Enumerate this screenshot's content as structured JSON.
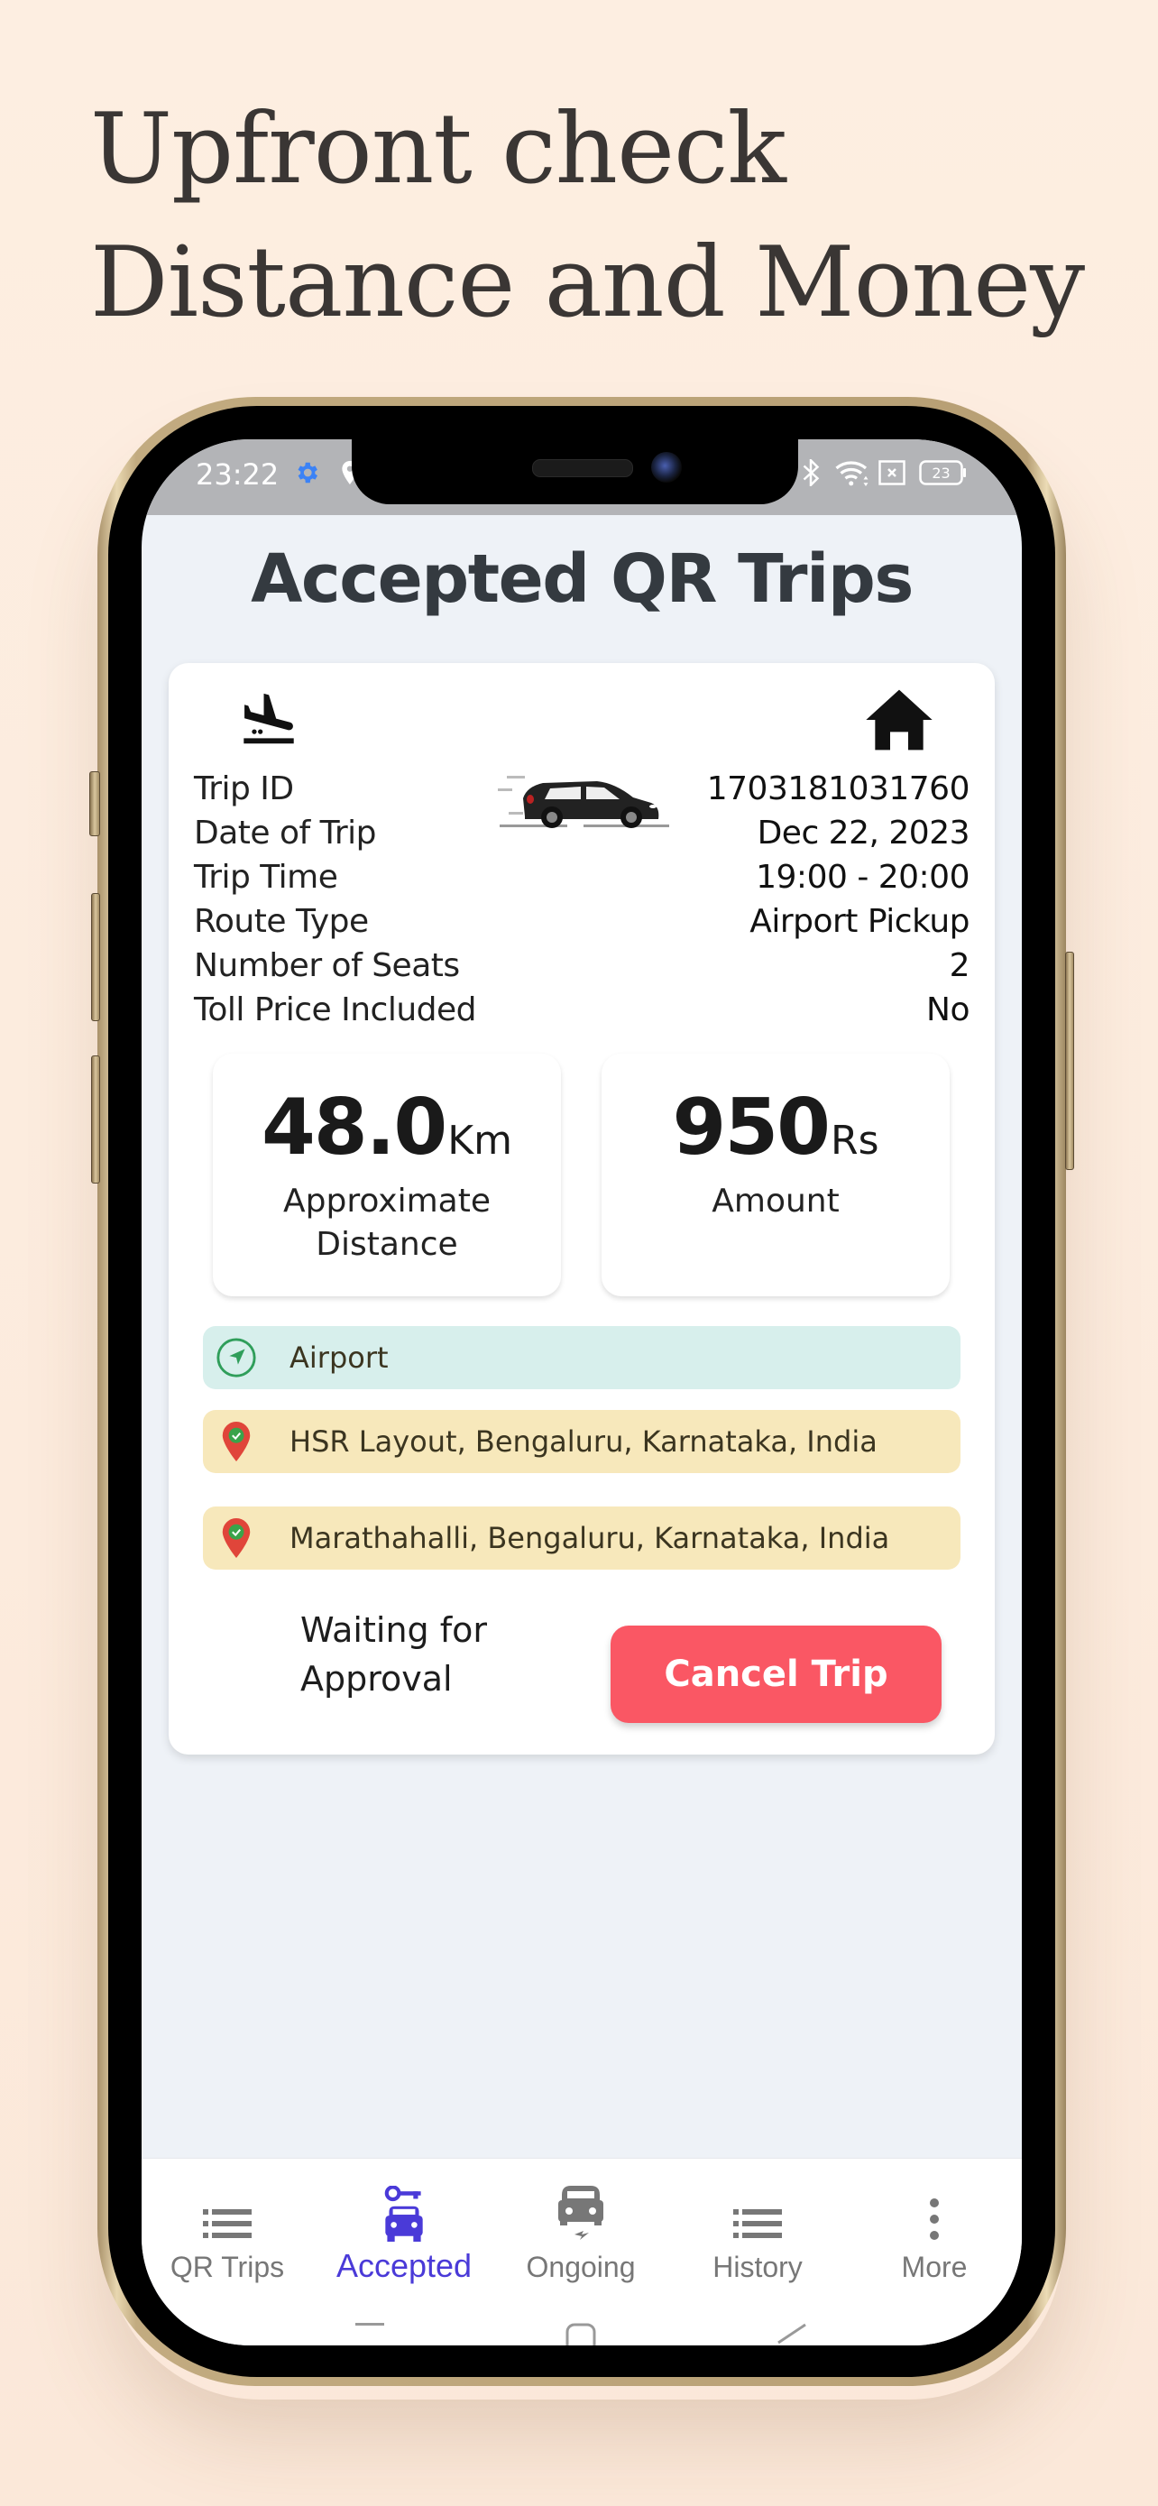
{
  "promo": {
    "headline_line1": "Upfront check",
    "headline_line2": "Distance and Money"
  },
  "status_bar": {
    "time": "23:22",
    "battery": "23",
    "icons": [
      "settings-icon",
      "location-icon",
      "bluetooth-icon",
      "wifi-icon",
      "no-sim-icon",
      "battery-icon"
    ]
  },
  "app": {
    "title": "Accepted QR Trips"
  },
  "trip_card": {
    "pickup_icon": "airplane-landing-icon",
    "drop_icon": "home-icon",
    "details": [
      {
        "label": "Trip ID",
        "value": "1703181031760"
      },
      {
        "label": "Date of Trip",
        "value": "Dec 22, 2023"
      },
      {
        "label": "Trip Time",
        "value": "19:00 - 20:00"
      },
      {
        "label": "Route Type",
        "value": "Airport Pickup"
      },
      {
        "label": "Number of Seats",
        "value": "2"
      },
      {
        "label": "Toll Price Included",
        "value": "No"
      }
    ],
    "distance": {
      "value": "48.0",
      "unit": "Km",
      "label": "Approximate Distance"
    },
    "amount": {
      "value": "950",
      "unit": "Rs",
      "label": "Amount"
    },
    "locations": [
      {
        "type": "origin",
        "icon": "navigation-arrow-icon",
        "text": "Airport",
        "color": "#d7efec"
      },
      {
        "type": "stop",
        "icon": "map-pin-icon",
        "text": "HSR Layout, Bengaluru, Karnataka, India",
        "color": "#f7e8bb"
      },
      {
        "type": "stop",
        "icon": "map-pin-icon",
        "text": "Marathahalli, Bengaluru, Karnataka, India",
        "color": "#f7e8bb"
      }
    ],
    "status_text": "Waiting for Approval",
    "status_line1": "Waiting for",
    "status_line2": "Approval",
    "cancel_label": "Cancel Trip"
  },
  "bottom_nav": {
    "active_index": 1,
    "active_color": "#4a3ad8",
    "items": [
      {
        "label": "QR Trips",
        "icon": "list-icon"
      },
      {
        "label": "Accepted",
        "icon": "car-key-icon"
      },
      {
        "label": "Ongoing",
        "icon": "car-moving-icon"
      },
      {
        "label": "History",
        "icon": "list-icon"
      },
      {
        "label": "More",
        "icon": "more-vertical-icon"
      }
    ]
  },
  "colors": {
    "page_bg": "#fdeee1",
    "app_bg": "#eef2f7",
    "cancel_button": "#fa5764",
    "origin_pill": "#d7efec",
    "stop_pill": "#f7e8bb",
    "title_text": "#343a40"
  }
}
